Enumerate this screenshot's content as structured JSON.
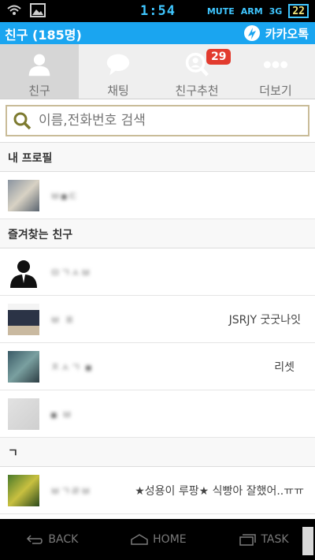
{
  "statusbar": {
    "time": "1:54",
    "mute": "MUTE",
    "arm": "ARM",
    "network": "3G",
    "battery": "22"
  },
  "app": {
    "title": "친구 (185명)",
    "brand": "카카오톡"
  },
  "tabs": [
    {
      "label": "친구",
      "icon": "person-icon",
      "active": true
    },
    {
      "label": "채팅",
      "icon": "chat-bubble-icon"
    },
    {
      "label": "친구추천",
      "icon": "friend-search-icon",
      "badge": "29"
    },
    {
      "label": "더보기",
      "icon": "more-dots-icon"
    }
  ],
  "search": {
    "placeholder": "이름,전화번호 검색"
  },
  "sections": {
    "my_profile": "내 프로필",
    "favorites": "즐겨찾는 친구",
    "index_g": "ㄱ"
  },
  "rows": {
    "profile": {
      "name": "ㅂ▪ㄷ"
    },
    "fav1": {
      "name": "ㅁㄱㅅㅂ"
    },
    "fav2": {
      "name": "ㅂ ㅍ",
      "status": "JSRJY 굿굿나잇"
    },
    "fav3": {
      "name": "ㅈㅅㄱ ▪",
      "status": "리셋"
    },
    "fav4": {
      "name": "▪ ㅂ"
    },
    "g1": {
      "name": "ㅂㄱㄹㅂ",
      "status": "★성용이 루팡★ 식빵아 잘했어..ㅠㅠ"
    }
  },
  "navbar": {
    "back": "BACK",
    "home": "HOME",
    "task": "TASK"
  }
}
